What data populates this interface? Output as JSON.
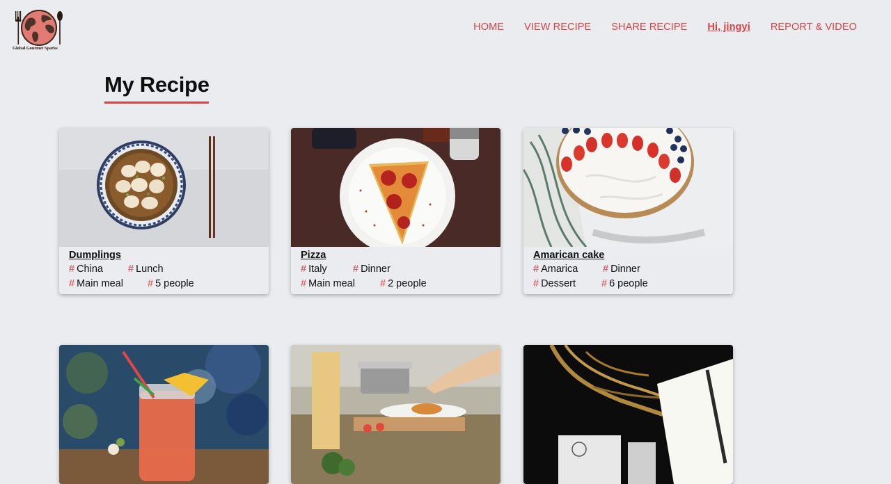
{
  "logo": {
    "text": "Global Gourmet Sparks"
  },
  "nav": {
    "items": [
      "HOME",
      "VIEW RECIPE",
      "SHARE RECIPE",
      "Hi, jingyi",
      "REPORT & VIDEO"
    ]
  },
  "page": {
    "title": "My Recipe"
  },
  "recipes": [
    {
      "title": "Dumplings",
      "tags": [
        "China",
        "Lunch",
        "Main meal",
        "5 people"
      ]
    },
    {
      "title": "Pizza",
      "tags": [
        "Italy",
        "Dinner",
        "Main meal",
        "2 people"
      ]
    },
    {
      "title": "Amarican cake",
      "tags": [
        "Amarica",
        "Dinner",
        "Dessert",
        "6 people"
      ]
    }
  ],
  "tag_symbol": "#",
  "colors": {
    "accent": "#d74343",
    "background": "#ebecf0"
  }
}
